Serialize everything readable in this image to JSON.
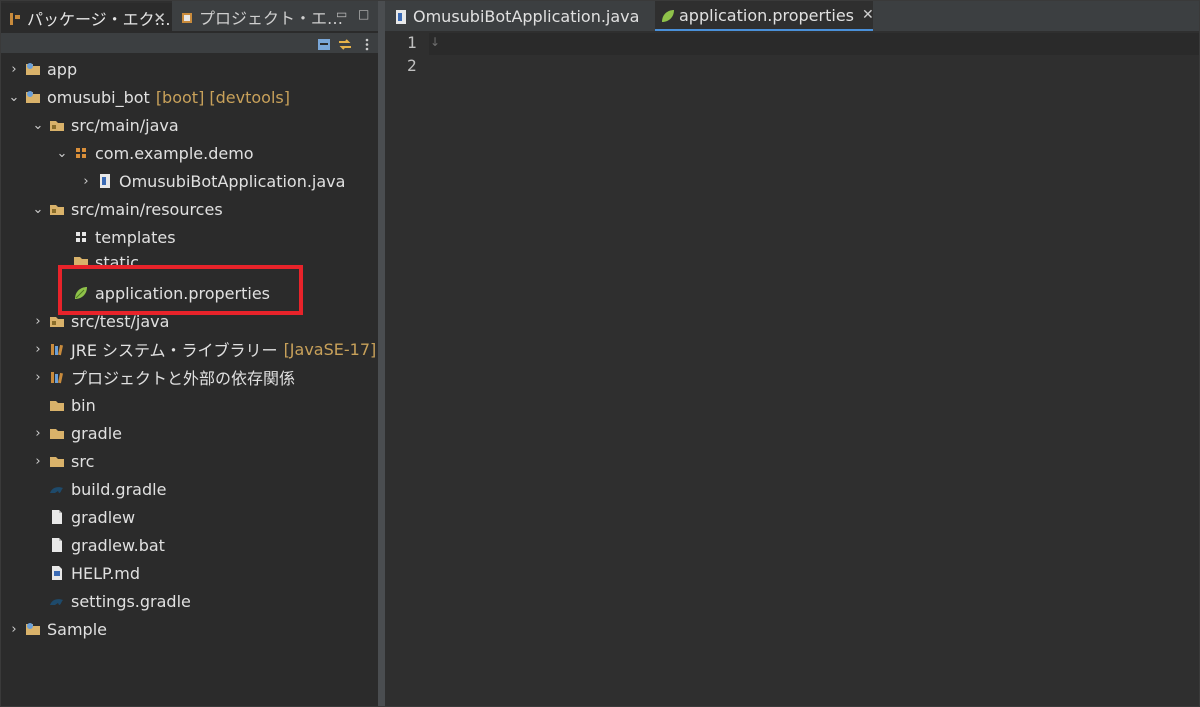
{
  "left_panel": {
    "tabs": [
      {
        "label": "パッケージ・エク…",
        "close": "✕"
      },
      {
        "label": "プロジェクト・エ…"
      }
    ],
    "window_buttons": [
      "▭",
      "□"
    ],
    "tree": [
      {
        "label": "app",
        "icon": "project-icon",
        "expanded": false
      },
      {
        "label": "omusubi_bot",
        "deco": "[boot] [devtools]",
        "icon": "project-icon",
        "expanded": true
      },
      {
        "label": "src/main/java",
        "icon": "source-folder-icon",
        "expanded": true
      },
      {
        "label": "com.example.demo",
        "icon": "package-icon",
        "expanded": true
      },
      {
        "label": "OmusubiBotApplication.java",
        "icon": "java-file-icon",
        "expanded": false
      },
      {
        "label": "src/main/resources",
        "icon": "source-folder-icon",
        "expanded": true
      },
      {
        "label": "templates",
        "icon": "package-icon"
      },
      {
        "label": "static",
        "icon": "folder-icon"
      },
      {
        "label": "application.properties",
        "icon": "spring-leaf-icon"
      },
      {
        "label": "src/test/java",
        "icon": "source-folder-icon",
        "expanded": false
      },
      {
        "label": "JRE システム・ライブラリー",
        "deco": "[JavaSE-17]",
        "icon": "library-icon",
        "expanded": false
      },
      {
        "label": "プロジェクトと外部の依存関係",
        "icon": "library-icon",
        "expanded": false
      },
      {
        "label": "bin",
        "icon": "folder-icon"
      },
      {
        "label": "gradle",
        "icon": "folder-icon",
        "expanded": false
      },
      {
        "label": "src",
        "icon": "folder-icon",
        "expanded": false
      },
      {
        "label": "build.gradle",
        "icon": "gradle-icon"
      },
      {
        "label": "gradlew",
        "icon": "file-icon"
      },
      {
        "label": "gradlew.bat",
        "icon": "file-icon"
      },
      {
        "label": "HELP.md",
        "icon": "markdown-icon"
      },
      {
        "label": "settings.gradle",
        "icon": "gradle-icon"
      },
      {
        "label": "Sample",
        "icon": "project-icon",
        "expanded": false
      }
    ]
  },
  "editor": {
    "tabs": [
      {
        "label": "OmusubiBotApplication.java"
      },
      {
        "label": "application.properties",
        "close": "✕"
      }
    ],
    "line_numbers": [
      "1",
      "2"
    ]
  },
  "colors": {
    "highlight": "#e8232a",
    "decoration": "#c8a15a",
    "active_tab_underline": "#4a90d9"
  }
}
